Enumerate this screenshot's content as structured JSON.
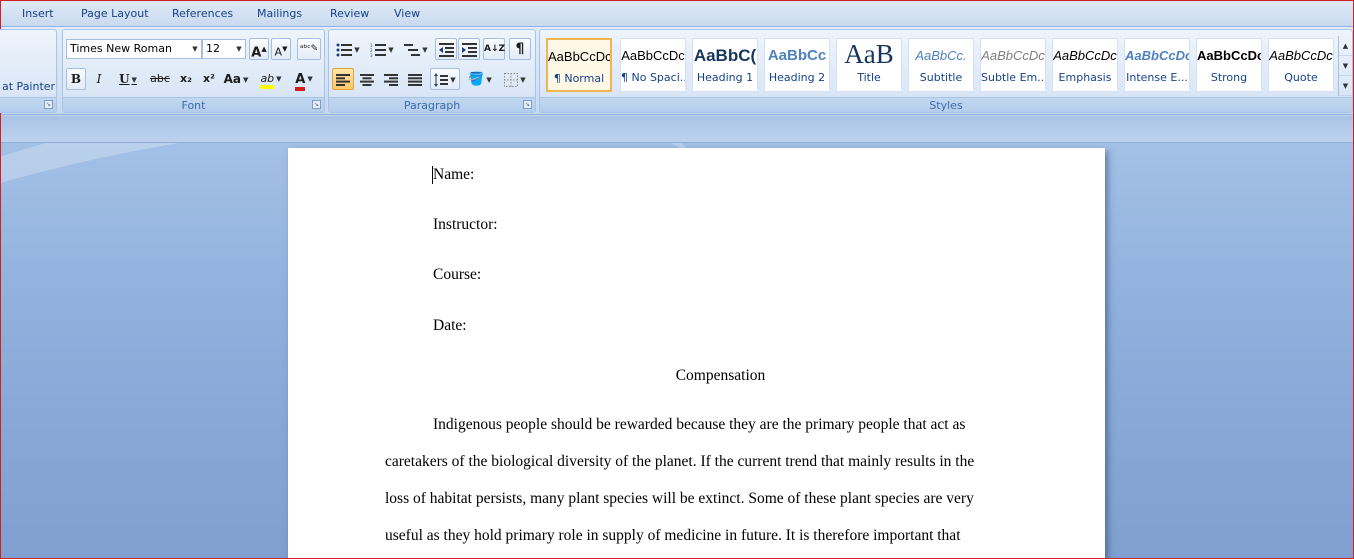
{
  "tabs": [
    "Insert",
    "Page Layout",
    "References",
    "Mailings",
    "Review",
    "View"
  ],
  "clipboard": {
    "format_painter_label": "at Painter"
  },
  "font": {
    "group_label": "Font",
    "font_name": "Times New Roman",
    "font_size": "12",
    "bold": "B",
    "italic": "I",
    "underline": "U",
    "strikethrough": "abc",
    "subscript": "x₂",
    "superscript": "x²",
    "change_case": "Aa",
    "grow_font": "A",
    "shrink_font": "A",
    "highlight": "ab",
    "font_color": "A"
  },
  "paragraph": {
    "group_label": "Paragraph",
    "pilcrow": "¶"
  },
  "styles": {
    "group_label": "Styles",
    "items": [
      {
        "sample": "AaBbCcDc",
        "name": "¶ Normal"
      },
      {
        "sample": "AaBbCcDc",
        "name": "¶ No Spaci..."
      },
      {
        "sample": "AaBbC(",
        "name": "Heading 1"
      },
      {
        "sample": "AaBbCc",
        "name": "Heading 2"
      },
      {
        "sample": "AaB",
        "name": "Title"
      },
      {
        "sample": "AaBbCc.",
        "name": "Subtitle"
      },
      {
        "sample": "AaBbCcDc",
        "name": "Subtle Em..."
      },
      {
        "sample": "AaBbCcDc",
        "name": "Emphasis"
      },
      {
        "sample": "AaBbCcDc",
        "name": "Intense E..."
      },
      {
        "sample": "AaBbCcDc",
        "name": "Strong"
      },
      {
        "sample": "AaBbCcDc",
        "name": "Quote"
      }
    ]
  },
  "document": {
    "name_label": "Name:",
    "instructor_label": "Instructor:",
    "course_label": "Course:",
    "date_label": "Date:",
    "title": "Compensation",
    "lines": [
      "Indigenous people should be rewarded because they are the primary  people that act as",
      "caretakers of the biological  diversity of the planet. If the current trend that mainly results in the",
      "loss of habitat persists, many plant species  will be extinct. Some of these plant species are very",
      "useful as they hold primary  role in supply of medicine in  future. It is therefore important that"
    ]
  },
  "colors": {
    "accent": "#15428b",
    "highlight": "#ffff00",
    "font_color": "#d41c1c",
    "selected_style": "#f2b451"
  }
}
